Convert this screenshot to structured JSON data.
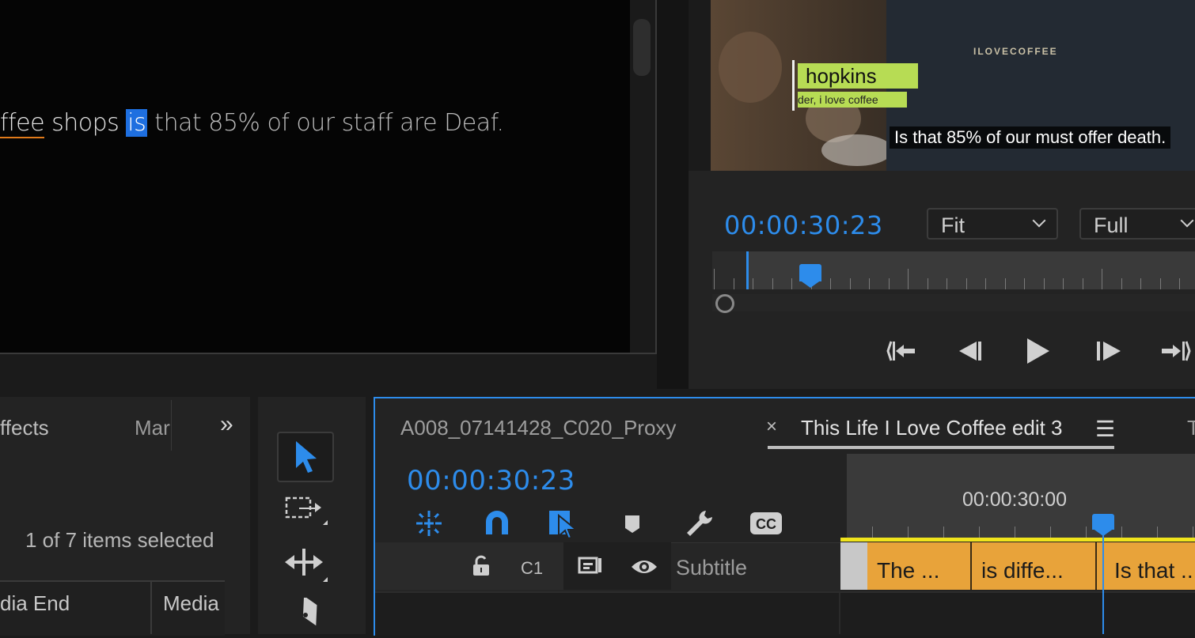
{
  "text_panel": {
    "transcript": {
      "w1": "ffee",
      "w2": " shops ",
      "highlight": "is",
      "rest": " that 85% of our staff are Deaf."
    }
  },
  "program_monitor": {
    "apron_text": "ILOVECOFFEE",
    "lower_third_name": "hopkins",
    "lower_third_sub": "der, i love coffee",
    "caption": "Is that 85% of our must offer death.",
    "timecode": "00:00:30:23",
    "zoom_select": "Fit",
    "resolution_select": "Full",
    "transport": {
      "go_to_in": "go-to-in-icon",
      "step_back": "step-back-icon",
      "play": "play-icon",
      "step_forward": "step-forward-icon",
      "go_to_out": "go-to-out-icon"
    }
  },
  "left_panel": {
    "tabs": [
      "ffects",
      "Mar"
    ],
    "more": "»",
    "items_selected": "1 of 7 items selected",
    "columns": [
      "dia End",
      "Media"
    ]
  },
  "timeline": {
    "tab_proxy": "A008_07141428_C020_Proxy",
    "tab_close": "×",
    "tab_active": "This Life I Love Coffee edit 3",
    "tab_menu": "☰",
    "tab_next": "T",
    "timecode": "00:00:30:23",
    "ruler_time": "00:00:30:00",
    "track": {
      "c1": "C1",
      "name": "Subtitle"
    },
    "clips": [
      "The ...",
      "is diffe...",
      "Is that ..."
    ]
  },
  "colors": {
    "accent": "#2d8ceb",
    "clip": "#e8a33a",
    "lower_third": "#b7dc54",
    "selection_highlight": "#1e6fe0"
  }
}
